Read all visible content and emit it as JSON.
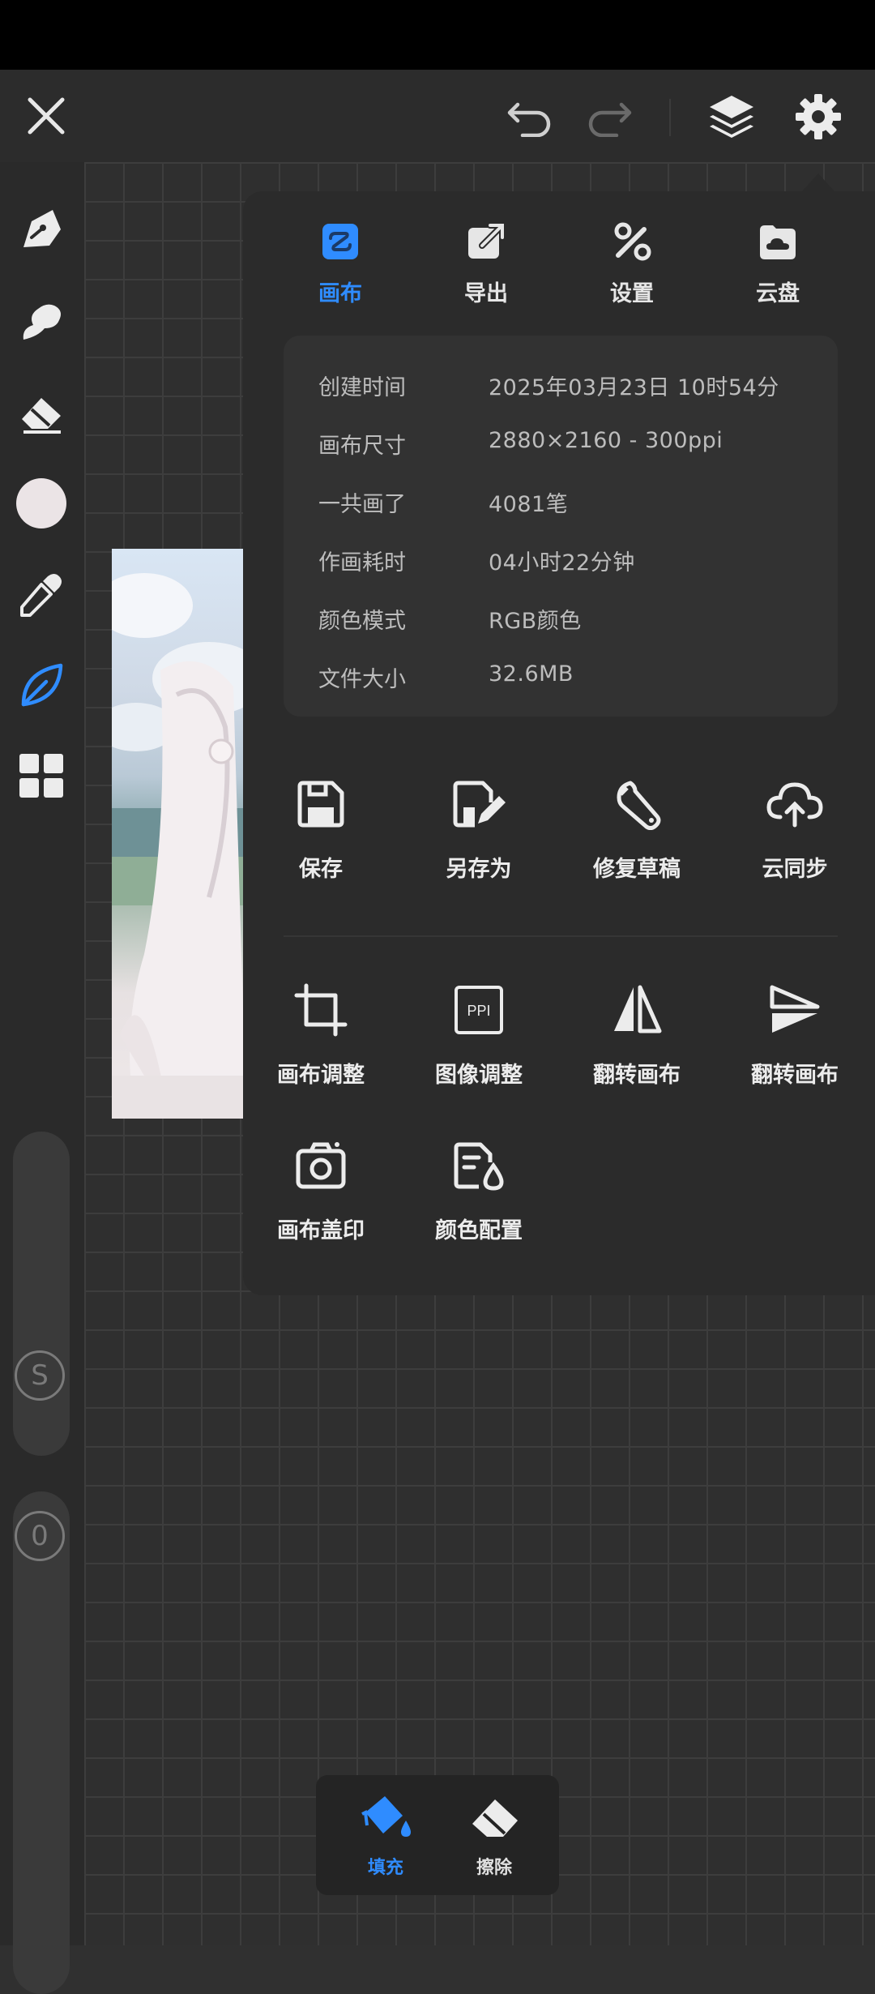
{
  "colors": {
    "accent": "#2f8cff",
    "panel": "#2b2b2b",
    "grid": "#2f2f2f"
  },
  "topbar": {
    "close_icon": "close-icon",
    "undo_icon": "undo-icon",
    "redo_icon": "redo-icon",
    "layers_icon": "layers-icon",
    "settings_icon": "gear-icon"
  },
  "tools": [
    "pen-tip-icon",
    "smudge-icon",
    "eraser-icon",
    "color-swatch-icon",
    "eyedropper-icon",
    "leaf-brush-icon",
    "grid-apps-icon"
  ],
  "sliders": {
    "size_badge": "S",
    "opacity_badge": "0"
  },
  "panel": {
    "tabs": [
      {
        "label": "画布",
        "icon": "canvas-icon",
        "active": true
      },
      {
        "label": "导出",
        "icon": "export-icon",
        "active": false
      },
      {
        "label": "设置",
        "icon": "tools-icon",
        "active": false
      },
      {
        "label": "云盘",
        "icon": "cloud-drive-icon",
        "active": false
      }
    ],
    "info": [
      {
        "key": "创建时间",
        "value": "2025年03月23日 10时54分"
      },
      {
        "key": "画布尺寸",
        "value": "2880×2160 - 300ppi"
      },
      {
        "key": "一共画了",
        "value": "4081笔"
      },
      {
        "key": "作画耗时",
        "value": "04小时22分钟"
      },
      {
        "key": "颜色模式",
        "value": "RGB颜色"
      },
      {
        "key": "文件大小",
        "value": "32.6MB"
      }
    ],
    "actions_row1": [
      {
        "label": "保存",
        "icon": "save-icon"
      },
      {
        "label": "另存为",
        "icon": "save-as-icon"
      },
      {
        "label": "修复草稿",
        "icon": "wrench-icon"
      },
      {
        "label": "云同步",
        "icon": "cloud-sync-icon"
      }
    ],
    "actions_row2": [
      {
        "label": "画布调整",
        "icon": "crop-icon"
      },
      {
        "label": "图像调整",
        "icon": "ppi-icon"
      },
      {
        "label": "翻转画布",
        "icon": "flip-horizontal-icon"
      },
      {
        "label": "翻转画布",
        "icon": "flip-vertical-icon"
      }
    ],
    "actions_row3": [
      {
        "label": "画布盖印",
        "icon": "camera-icon"
      },
      {
        "label": "颜色配置",
        "icon": "color-config-icon"
      }
    ]
  },
  "bottom_tool": {
    "fill_label": "填充",
    "erase_label": "擦除"
  }
}
